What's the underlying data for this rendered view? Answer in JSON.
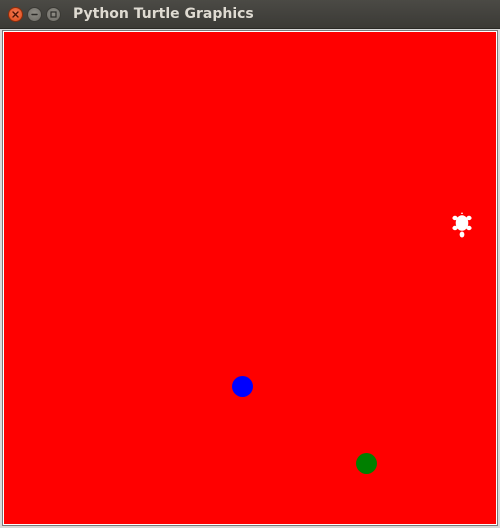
{
  "window": {
    "title": "Python Turtle Graphics",
    "close_icon": "close-icon",
    "minimize_icon": "minimize-icon",
    "maximize_icon": "maximize-icon"
  },
  "canvas": {
    "background_color": "#ff0000",
    "dots": [
      {
        "name": "blue-dot",
        "color": "#0000ff"
      },
      {
        "name": "green-dot",
        "color": "#007f00"
      }
    ],
    "turtle": {
      "icon": "turtle-icon",
      "color": "#ffffff",
      "heading": "down"
    }
  }
}
